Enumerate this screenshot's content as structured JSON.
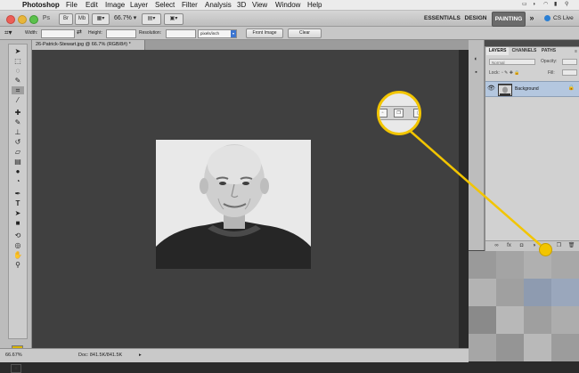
{
  "menubar": {
    "apple_icon": "apple-icon",
    "app_name": "Photoshop",
    "menus": [
      "File",
      "Edit",
      "Image",
      "Layer",
      "Select",
      "Filter",
      "Analysis",
      "3D",
      "View",
      "Window",
      "Help"
    ]
  },
  "appbar": {
    "ps_badge": "Ps",
    "zoom": "66.7",
    "workspaces": [
      "ESSENTIALS",
      "DESIGN",
      "PAINTING"
    ],
    "active_workspace": "PAINTING",
    "more": "»",
    "cs_live": "CS Live"
  },
  "options_bar": {
    "width_label": "Width:",
    "height_label": "Height:",
    "resolution_label": "Resolution:",
    "units": "pixels/inch",
    "front_image": "Front Image",
    "clear": "Clear"
  },
  "document": {
    "tab_title": "26-Patrick-Stewart.jpg @ 66.7% (RGB/8#) *",
    "status_zoom": "66.67%",
    "status_doc": "Doc: 841.5K/841.5K",
    "status_arrow": "▸"
  },
  "panels": {
    "tabs": [
      "LAYERS",
      "CHANNELS",
      "PATHS"
    ],
    "blend_mode": "Normal",
    "opacity_label": "Opacity:",
    "lock_label": "Lock:",
    "fill_label": "Fill:",
    "layer_name": "Background",
    "footer_icons": [
      "link-icon",
      "fx-icon",
      "mask-icon",
      "adjustment-icon",
      "group-icon",
      "new-layer-icon",
      "trash-icon"
    ]
  },
  "colors": {
    "accent_callout": "#f2c500",
    "foreground_color": "#d9b400",
    "selected_layer": "#b4c7df"
  }
}
